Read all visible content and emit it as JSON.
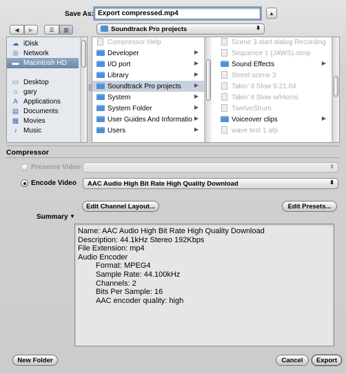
{
  "save_as": {
    "label": "Save As:",
    "filename": "Export compressed.mp4"
  },
  "location_popup": {
    "value": "Soundtrack Pro projects"
  },
  "sidebar": {
    "items": [
      {
        "label": "iDisk",
        "icon": "idisk-icon"
      },
      {
        "label": "Network",
        "icon": "network-icon"
      },
      {
        "label": "Macintosh HD",
        "icon": "harddisk-icon",
        "selected": true
      },
      {
        "label": "Desktop",
        "icon": "desktop-icon"
      },
      {
        "label": "gary",
        "icon": "home-icon"
      },
      {
        "label": "Applications",
        "icon": "applications-icon"
      },
      {
        "label": "Documents",
        "icon": "documents-icon"
      },
      {
        "label": "Movies",
        "icon": "movies-icon"
      },
      {
        "label": "Music",
        "icon": "music-icon"
      }
    ]
  },
  "column1": {
    "items": [
      {
        "label": "Compressor Help",
        "dim": true
      },
      {
        "label": "Developer",
        "folder": true
      },
      {
        "label": "I/O port",
        "folder": true
      },
      {
        "label": "Library",
        "folder": true
      },
      {
        "label": "Soundtrack Pro projects",
        "folder": true,
        "selected": true
      },
      {
        "label": "System",
        "folder": true
      },
      {
        "label": "System Folder",
        "folder": true
      },
      {
        "label": "User Guides And Informatio",
        "folder": true
      },
      {
        "label": "Users",
        "folder": true
      }
    ]
  },
  "column2": {
    "items": [
      {
        "label": "Scene 3 start dialog Recording",
        "dim": true
      },
      {
        "label": "Sequence 1 (JAWS).stmp",
        "dim": true
      },
      {
        "label": "Sound Effects",
        "folder": true
      },
      {
        "label": "Street scene 3",
        "dim": true
      },
      {
        "label": "Takin' it Slow 9.21.04",
        "dim": true
      },
      {
        "label": "Takin' it Slow w/Horns",
        "dim": true
      },
      {
        "label": "TwelveStrum",
        "dim": true
      },
      {
        "label": "Voiceover clips",
        "folder": true
      },
      {
        "label": "wave test 1.afp",
        "dim": true
      }
    ]
  },
  "compressor": {
    "section_title": "Compressor",
    "preserve_label": "Preserve Video",
    "encode_label": "Encode Video",
    "encode_value": "AAC Audio High Bit Rate High Quality Download",
    "edit_channel_label": "Edit Channel Layout...",
    "edit_presets_label": "Edit Presets...",
    "summary_label": "Summary"
  },
  "summary_lines": [
    {
      "text": "Name: AAC Audio High Bit Rate High Quality Download",
      "indent": false
    },
    {
      "text": "Description: 44.1kHz Stereo 192Kbps",
      "indent": false
    },
    {
      "text": "File Extension: mp4",
      "indent": false
    },
    {
      "text": "Audio Encoder",
      "indent": false
    },
    {
      "text": "Format: MPEG4",
      "indent": true
    },
    {
      "text": "Sample Rate: 44.100kHz",
      "indent": true
    },
    {
      "text": "Channels: 2",
      "indent": true
    },
    {
      "text": "Bits Per Sample: 16",
      "indent": true
    },
    {
      "text": "AAC encoder quality: high",
      "indent": true
    }
  ],
  "buttons": {
    "new_folder": "New Folder",
    "cancel": "Cancel",
    "export": "Export"
  },
  "colors": {
    "selection": "#7f99bc",
    "focus_ring": "#7fa4d6",
    "folder_blue": "#4f8fd6"
  }
}
